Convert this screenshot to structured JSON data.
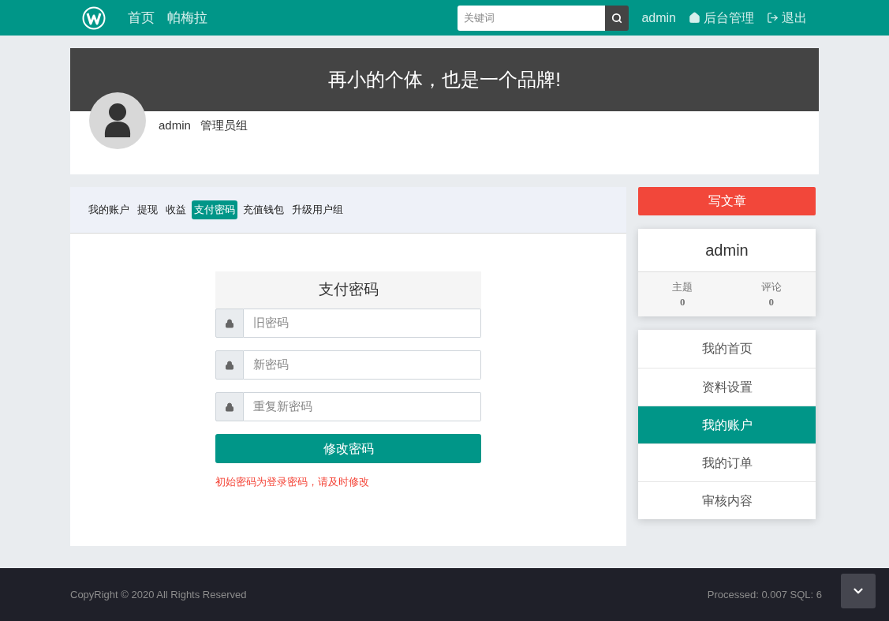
{
  "navbar": {
    "links": [
      "首页",
      "帕梅拉"
    ],
    "search": {
      "placeholder": "关键词"
    },
    "user": "admin",
    "admin_link": "后台管理",
    "logout": "退出"
  },
  "banner": {
    "slogan": "再小的个体，也是一个品牌!",
    "username": "admin",
    "group": "管理员组"
  },
  "tabs": [
    {
      "label": "我的账户",
      "selected": false
    },
    {
      "label": "提现",
      "selected": false
    },
    {
      "label": "收益",
      "selected": false
    },
    {
      "label": "支付密码",
      "selected": true
    },
    {
      "label": "充值钱包",
      "selected": false
    },
    {
      "label": "升级用户组",
      "selected": false
    }
  ],
  "form": {
    "title": "支付密码",
    "fields": [
      {
        "placeholder": "旧密码"
      },
      {
        "placeholder": "新密码"
      },
      {
        "placeholder": "重复新密码"
      }
    ],
    "submit": "修改密码",
    "note": "初始密码为登录密码，请及时修改"
  },
  "sidebar": {
    "write_button": "写文章",
    "profile": {
      "name": "admin",
      "stats": [
        {
          "label": "主题",
          "value": "0"
        },
        {
          "label": "评论",
          "value": "0"
        }
      ]
    },
    "menu": [
      {
        "label": "我的首页",
        "selected": false
      },
      {
        "label": "资料设置",
        "selected": false
      },
      {
        "label": "我的账户",
        "selected": true
      },
      {
        "label": "我的订单",
        "selected": false
      },
      {
        "label": "审核内容",
        "selected": false
      }
    ]
  },
  "footer": {
    "copyright": "CopyRight © 2020 All Rights Reserved",
    "stats": "Processed: 0.007 SQL: 6"
  }
}
